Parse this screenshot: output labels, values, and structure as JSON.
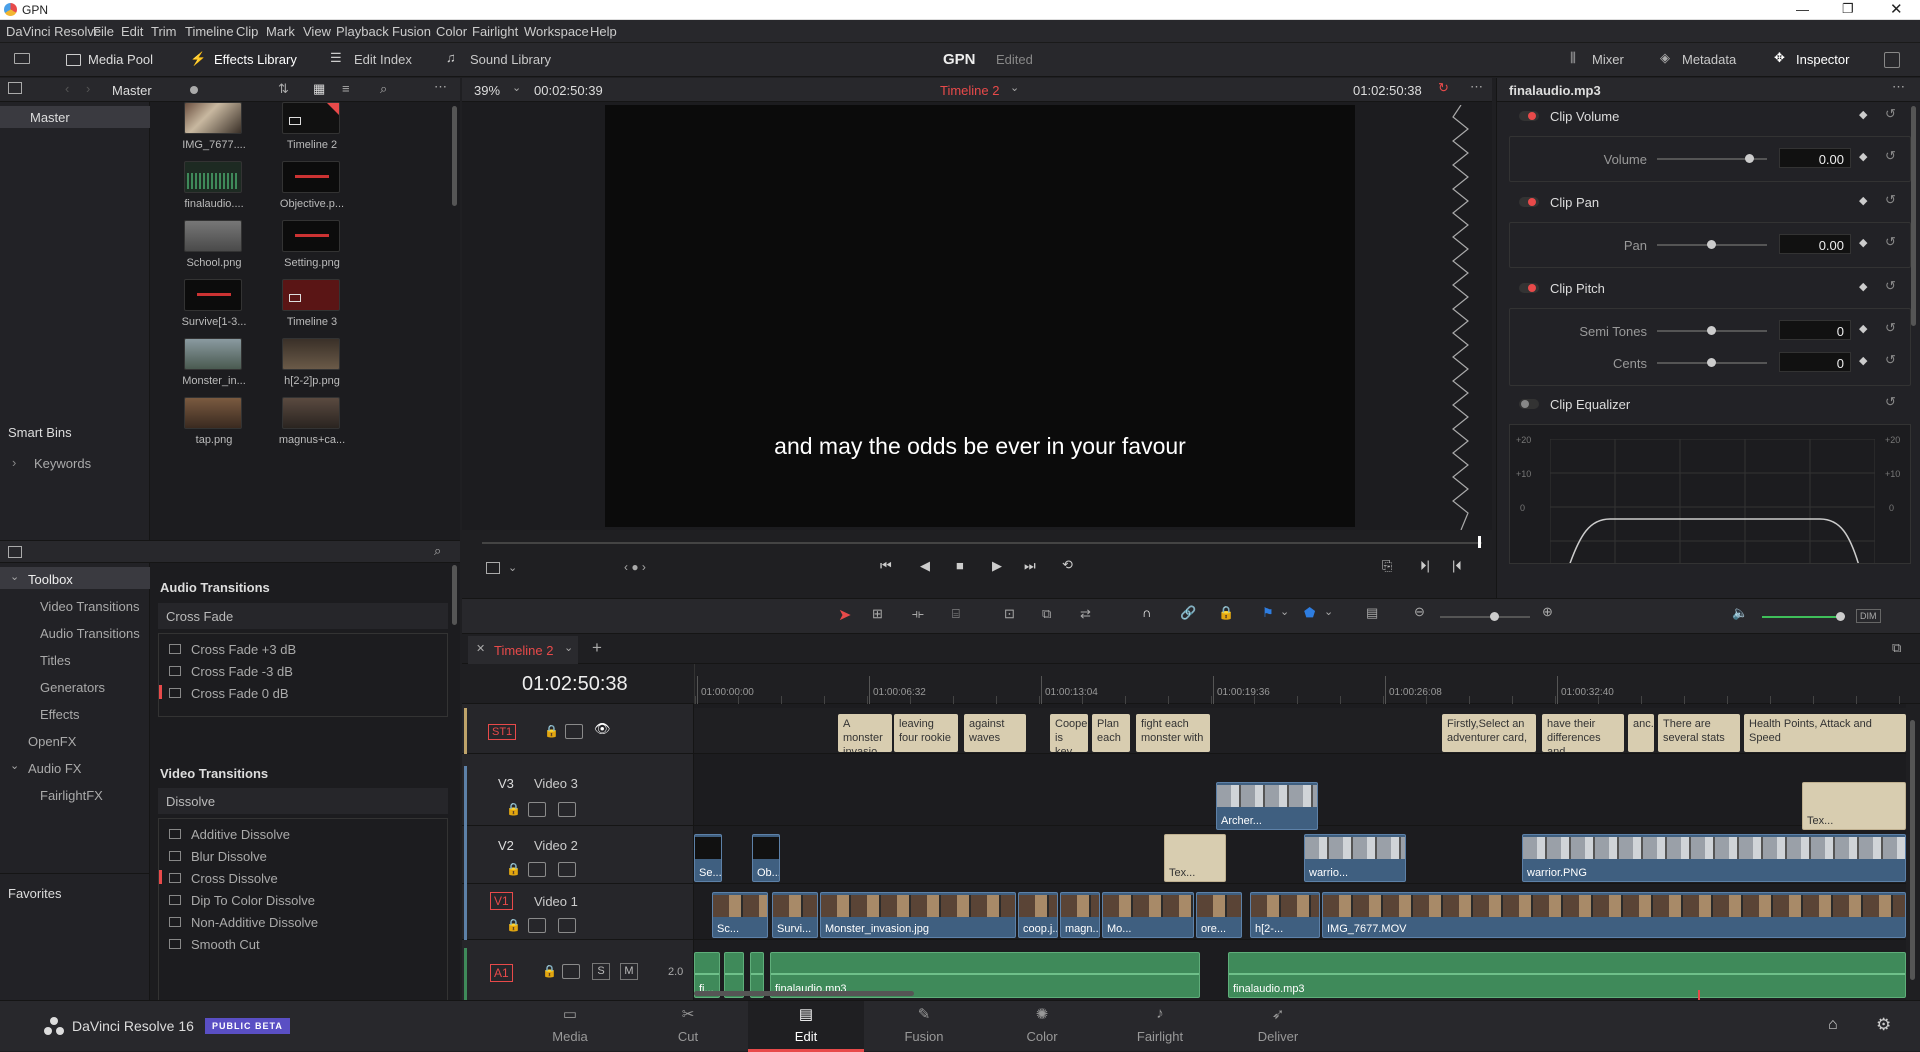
{
  "window": {
    "title": "GPN"
  },
  "menu": [
    "DaVinci Resolve",
    "File",
    "Edit",
    "Trim",
    "Timeline",
    "Clip",
    "Mark",
    "View",
    "Playback",
    "Fusion",
    "Color",
    "Fairlight",
    "Workspace",
    "Help"
  ],
  "toolbar": {
    "media_pool": "Media Pool",
    "effects_library": "Effects Library",
    "edit_index": "Edit Index",
    "sound_library": "Sound Library",
    "project": "GPN",
    "project_status": "Edited",
    "mixer": "Mixer",
    "metadata": "Metadata",
    "inspector": "Inspector"
  },
  "media_pool": {
    "bin": "Master",
    "tree_master": "Master",
    "smart_bins": "Smart Bins",
    "keywords": "Keywords",
    "items": [
      {
        "name": "IMG_7677...."
      },
      {
        "name": "Timeline 2"
      },
      {
        "name": "finalaudio...."
      },
      {
        "name": "Objective.p..."
      },
      {
        "name": "School.png"
      },
      {
        "name": "Setting.png"
      },
      {
        "name": "Survive[1-3..."
      },
      {
        "name": "Timeline 3"
      },
      {
        "name": "Monster_in..."
      },
      {
        "name": "h[2-2]p.png"
      },
      {
        "name": "tap.png"
      },
      {
        "name": "magnus+ca..."
      }
    ]
  },
  "viewer": {
    "zoom": "39%",
    "timecode_left": "00:02:50:39",
    "timeline_name": "Timeline 2",
    "timecode_right": "01:02:50:38",
    "subtitle": "and may the odds be ever in your favour"
  },
  "effects": {
    "toolbox": "Toolbox",
    "video_transitions": "Video Transitions",
    "audio_transitions": "Audio Transitions",
    "titles": "Titles",
    "generators": "Generators",
    "effects": "Effects",
    "openfx": "OpenFX",
    "audio_fx": "Audio FX",
    "fairlight_fx": "FairlightFX",
    "favorites": "Favorites",
    "audio_header": "Audio Transitions",
    "cross_fade": "Cross Fade",
    "audio_items": [
      "Cross Fade +3 dB",
      "Cross Fade -3 dB",
      "Cross Fade 0 dB"
    ],
    "video_header": "Video Transitions",
    "dissolve": "Dissolve",
    "video_items": [
      "Additive Dissolve",
      "Blur Dissolve",
      "Cross Dissolve",
      "Dip To Color Dissolve",
      "Non-Additive Dissolve",
      "Smooth Cut"
    ]
  },
  "inspector": {
    "clip_name": "finalaudio.mp3",
    "clip_volume": "Clip Volume",
    "volume_label": "Volume",
    "volume_value": "0.00",
    "clip_pan": "Clip Pan",
    "pan_label": "Pan",
    "pan_value": "0.00",
    "clip_pitch": "Clip Pitch",
    "semi_tones_label": "Semi Tones",
    "semi_tones_value": "0",
    "cents_label": "Cents",
    "cents_value": "0",
    "clip_equalizer": "Clip Equalizer",
    "eq_scale": [
      "+20",
      "+10",
      "0"
    ]
  },
  "timeline": {
    "tab": "Timeline 2",
    "timecode": "01:02:50:38",
    "ruler": [
      "01:00:00:00",
      "01:00:06:32",
      "01:00:13:04",
      "01:00:19:36",
      "01:00:26:08",
      "01:00:32:40"
    ],
    "tracks": {
      "st1": "ST1",
      "v3": "V3",
      "v3_name": "Video 3",
      "v2": "V2",
      "v2_name": "Video 2",
      "v1": "V1",
      "v1_name": "Video 1",
      "a1": "A1",
      "a1_channels": "2.0",
      "s": "S",
      "m": "M"
    },
    "subtitles": [
      "A monster invasio...",
      "leaving four rookie",
      "against waves",
      "Cooper is key",
      "Plan each",
      "fight each monster with",
      "Firstly,Select an adventurer card,",
      "have their differences and",
      "anc...",
      "There are several stats",
      "Health Points, Attack and Speed"
    ],
    "v3_clips": [
      "Archer...",
      "Tex..."
    ],
    "v2_clips": [
      "Se...",
      "Ob...",
      "Tex...",
      "warrio...",
      "warrior.PNG"
    ],
    "v1_clips": [
      "Sc...",
      "Survi...",
      "Monster_invasion.jpg",
      "coop.j...",
      "magn...",
      "Mo...",
      "ore...",
      "h[2-...",
      "IMG_7677.MOV"
    ],
    "a1_clips": [
      "fi...",
      "finalaudio.mp3",
      "finalaudio.mp3"
    ]
  },
  "footer": {
    "app": "DaVinci Resolve 16",
    "badge": "PUBLIC BETA",
    "pages": [
      "Media",
      "Cut",
      "Edit",
      "Fusion",
      "Color",
      "Fairlight",
      "Deliver"
    ],
    "active": "Edit"
  },
  "colors": {
    "accent_red": "#e84a4a",
    "clip_blue": "#3f5f80",
    "audio_green": "#3f8a5a",
    "subtitle_clip": "#d8cdb0",
    "badge": "#5a4fc4"
  }
}
